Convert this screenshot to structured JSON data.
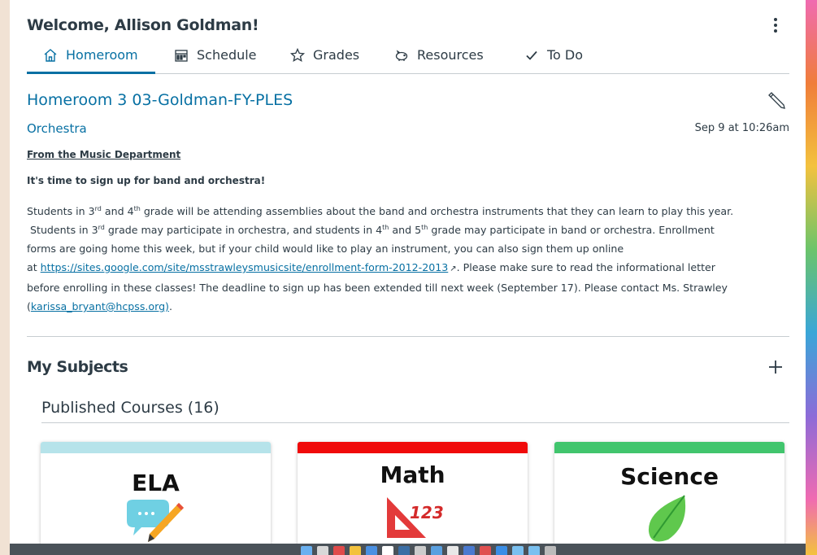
{
  "header": {
    "welcome": "Welcome, Allison Goldman!"
  },
  "tabs": [
    {
      "label": "Homeroom",
      "icon": "home-icon",
      "active": true
    },
    {
      "label": "Schedule",
      "icon": "calendar-icon"
    },
    {
      "label": "Grades",
      "icon": "star-icon"
    },
    {
      "label": "Resources",
      "icon": "piggy-bank-icon"
    },
    {
      "label": "To Do",
      "icon": "checkmark-icon"
    }
  ],
  "announcement": {
    "course_title": "Homeroom 3 03-Goldman-FY-PLES",
    "title": "Orchestra",
    "date": "Sep 9 at 10:26am",
    "from": "From the Music Department",
    "headline": "It's time to sign up for band and orchestra!",
    "p1a": "Students in 3",
    "p1b": " and 4",
    "p1c": " grade will be attending assemblies about the band and orchestra instruments that they can learn to play this year.",
    "p2a": "Students in 3",
    "p2b": " grade may participate in orchestra, and students in 4",
    "p2c": " and 5",
    "p2d": " grade may participate in band or orchestra.   Enrollment",
    "p3": "forms are going home this week, but if your child would like to play an instrument, you can also sign them up online",
    "p4a": "at ",
    "link": "https://sites.google.com/site/msstrawleysmusicsite/enrollment-form-2012-2013",
    "p4b": ".  Please make sure to read the informational letter",
    "p5": "before enrolling in these classes!  The deadline to sign up has been extended till next week (September 17).  Please contact Ms. Strawley",
    "p6a": "(",
    "email": "karissa_bryant@hcpss.org)",
    "p6b": ".",
    "sup_rd": "rd",
    "sup_th": "th"
  },
  "subjects": {
    "heading": "My Subjects",
    "published": "Published Courses (16)",
    "cards": [
      {
        "name": "ELA",
        "color": "#b6e3ea"
      },
      {
        "name": "Math",
        "color": "#f00a0a"
      },
      {
        "name": "Science",
        "color": "#41c56d"
      }
    ]
  },
  "colors": {
    "accent": "#0770a3",
    "text": "#2d3b45"
  }
}
